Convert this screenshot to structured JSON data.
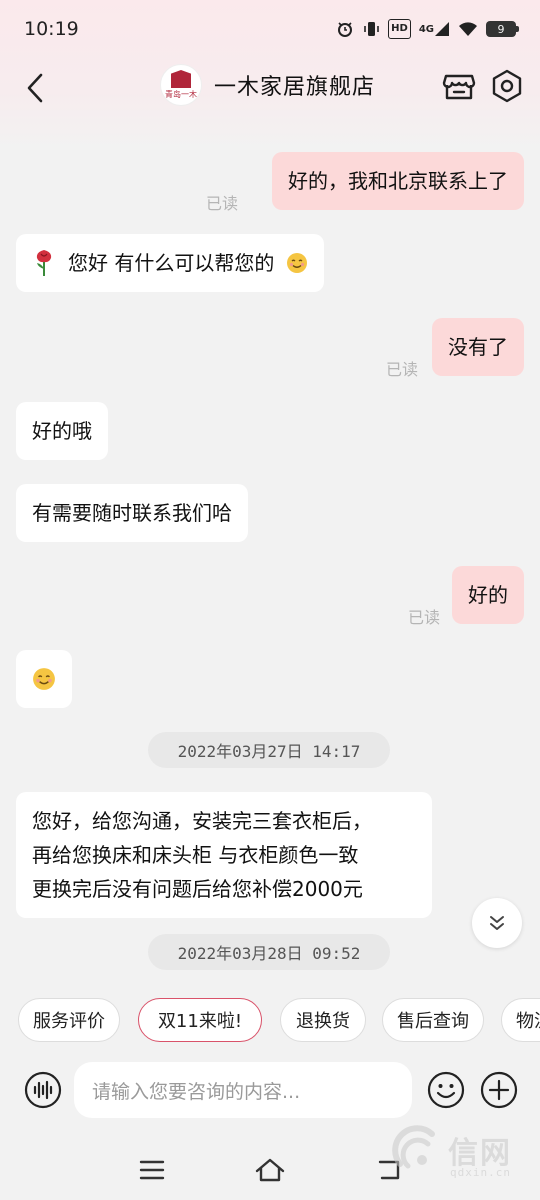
{
  "status_bar": {
    "time": "10:19",
    "hd": "HD",
    "network": "4G",
    "battery": "9"
  },
  "header": {
    "shop_name": "一木家居旗舰店",
    "logo_text": "青岛一木"
  },
  "messages": [
    {
      "side": "out",
      "text": "好的，我和北京联系上了",
      "read": "已读"
    },
    {
      "side": "in",
      "icon": "rose-emoji",
      "text": "您好  有什么可以帮您的",
      "emoji": "smile-emoji"
    },
    {
      "side": "out",
      "text": "没有了",
      "read": "已读"
    },
    {
      "side": "in",
      "text": "好的哦"
    },
    {
      "side": "in",
      "text": "有需要随时联系我们哈"
    },
    {
      "side": "out",
      "text": "好的",
      "read": "已读"
    },
    {
      "side": "in",
      "emoji": "smile-emoji"
    },
    {
      "type": "time",
      "text": "2022年03月27日  14:17"
    },
    {
      "side": "in",
      "lines": [
        "您好，给您沟通，安装完三套衣柜后，",
        "再给您换床和床头柜  与衣柜颜色一致",
        "更换完后没有问题后给您补偿2000元"
      ]
    },
    {
      "type": "time",
      "text": "2022年03月28日  09:52"
    }
  ],
  "quick_replies": [
    "服务评价",
    "双11来啦!",
    "退换货",
    "售后查询",
    "物流"
  ],
  "input": {
    "placeholder": "请输入您要咨询的内容..."
  },
  "watermark": {
    "text": "信网",
    "sub": "qdxin.cn"
  },
  "colors": {
    "accent": "#d9536a",
    "out_bubble": "#fcd9d9",
    "in_bubble": "#ffffff"
  }
}
